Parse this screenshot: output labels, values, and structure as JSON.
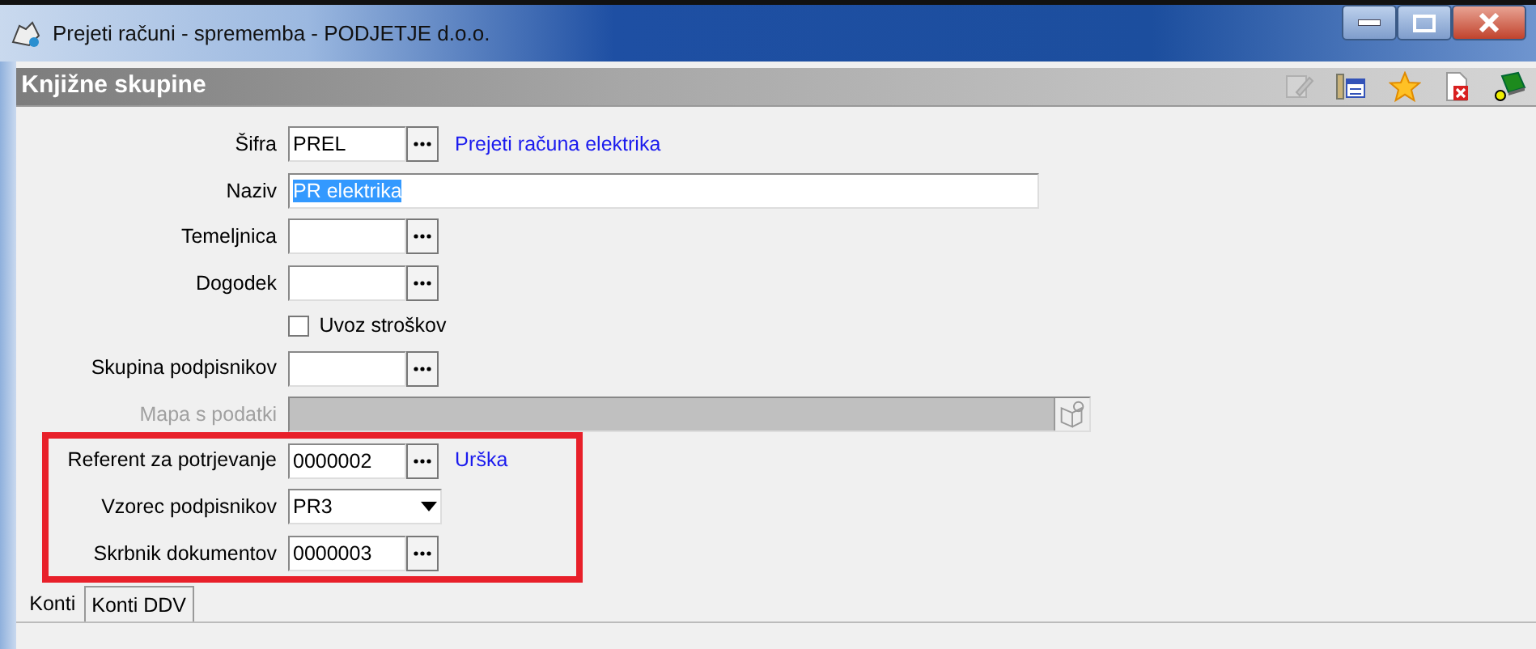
{
  "window": {
    "title": "Prejeti računi - sprememba - PODJETJE d.o.o."
  },
  "panel": {
    "title": "Knjižne skupine"
  },
  "toolbar": [
    {
      "kind": "edit",
      "disabled": true
    },
    {
      "kind": "columns",
      "disabled": false
    },
    {
      "kind": "favorite",
      "disabled": false
    },
    {
      "kind": "delete",
      "disabled": false
    },
    {
      "kind": "help",
      "disabled": false
    }
  ],
  "fields": [
    {
      "kind": "lookup",
      "label": "Šifra",
      "value": "PREL",
      "note": "Prejeti računa elektrika",
      "disabled": false
    },
    {
      "kind": "text",
      "label": "Naziv",
      "value": "PR elektrika",
      "text_selected": true,
      "disabled": false
    },
    {
      "kind": "lookup",
      "label": "Temeljnica",
      "disabled": false
    },
    {
      "kind": "lookup",
      "label": "Dogodek",
      "disabled": false
    },
    {
      "kind": "checkbox",
      "label": "Uvoz stroškov",
      "checked": false,
      "disabled": false
    },
    {
      "kind": "lookup",
      "label": "Skupina podpisnikov",
      "disabled": false
    },
    {
      "kind": "path",
      "label": "Mapa s podatki",
      "disabled": true
    }
  ],
  "highlighted_fields": [
    {
      "kind": "lookup",
      "label": "Referent za potrjevanje",
      "value": "0000002",
      "note": "Urška",
      "disabled": false
    },
    {
      "kind": "combo",
      "label": "Vzorec podpisnikov",
      "value": "PR3",
      "disabled": false
    },
    {
      "kind": "lookup",
      "label": "Skrbnik dokumentov",
      "value": "0000003",
      "disabled": false
    }
  ],
  "tabs": [
    {
      "label": "Konti",
      "selected": true
    },
    {
      "label": "Konti DDV",
      "selected": false
    }
  ]
}
